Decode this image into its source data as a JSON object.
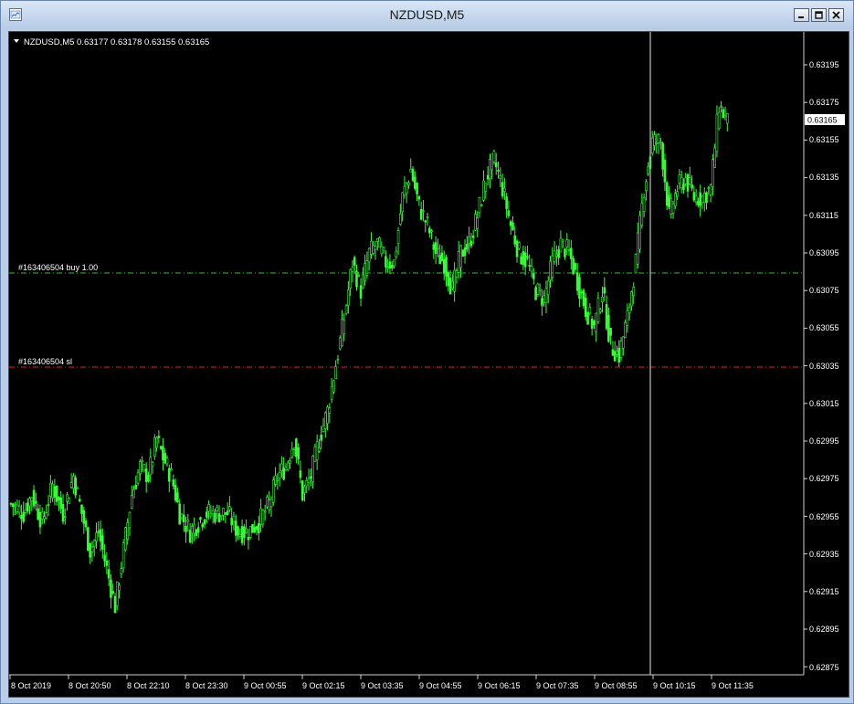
{
  "window": {
    "title": "NZDUSD,M5"
  },
  "chart": {
    "header": "NZDUSD,M5  0.63177 0.63178 0.63155 0.63165",
    "current_price": "0.63165",
    "y_ticks": [
      "0.63195",
      "0.63175",
      "0.63155",
      "0.63135",
      "0.63115",
      "0.63095",
      "0.63075",
      "0.63055",
      "0.63035",
      "0.63015",
      "0.62995",
      "0.62975",
      "0.62955",
      "0.62935",
      "0.62915",
      "0.62895",
      "0.62875"
    ],
    "x_ticks": [
      "8 Oct 2019",
      "8 Oct 20:50",
      "8 Oct 22:10",
      "8 Oct 23:30",
      "9 Oct 00:55",
      "9 Oct 02:15",
      "9 Oct 03:35",
      "9 Oct 04:55",
      "9 Oct 06:15",
      "9 Oct 07:35",
      "9 Oct 08:55",
      "9 Oct 10:15",
      "9 Oct 11:35"
    ],
    "buy_line_label": "#163406504 buy 1.00",
    "sl_line_label": "#163406504 sl",
    "colors": {
      "background": "#000000",
      "candles": "#33ff33",
      "buy_line": "#2fbf2f",
      "sl_line": "#e02020",
      "crosshair": "#e8e8e8",
      "text": "#ffffff"
    }
  },
  "chart_data": {
    "type": "candlestick",
    "symbol": "NZDUSD",
    "timeframe": "M5",
    "ylim": [
      0.62868,
      0.63214
    ],
    "buy_level": 0.63085,
    "sl_level": 0.63035,
    "close_path": [
      [
        0,
        0.6296
      ],
      [
        6,
        0.62955
      ],
      [
        10,
        0.62965
      ],
      [
        15,
        0.6295
      ],
      [
        20,
        0.6297
      ],
      [
        25,
        0.62955
      ],
      [
        30,
        0.62975
      ],
      [
        33,
        0.6296
      ],
      [
        38,
        0.62935
      ],
      [
        42,
        0.62945
      ],
      [
        47,
        0.6292
      ],
      [
        50,
        0.62905
      ],
      [
        54,
        0.62935
      ],
      [
        58,
        0.62965
      ],
      [
        62,
        0.6298
      ],
      [
        66,
        0.62975
      ],
      [
        70,
        0.62995
      ],
      [
        73,
        0.62985
      ],
      [
        77,
        0.62975
      ],
      [
        81,
        0.62955
      ],
      [
        86,
        0.62945
      ],
      [
        90,
        0.6295
      ],
      [
        94,
        0.62955
      ],
      [
        99,
        0.62955
      ],
      [
        104,
        0.62955
      ],
      [
        109,
        0.62945
      ],
      [
        114,
        0.62945
      ],
      [
        119,
        0.6295
      ],
      [
        124,
        0.6296
      ],
      [
        128,
        0.62975
      ],
      [
        132,
        0.6298
      ],
      [
        136,
        0.62995
      ],
      [
        140,
        0.62965
      ],
      [
        144,
        0.62975
      ],
      [
        148,
        0.62995
      ],
      [
        152,
        0.6301
      ],
      [
        156,
        0.63035
      ],
      [
        160,
        0.6306
      ],
      [
        164,
        0.6309
      ],
      [
        168,
        0.63075
      ],
      [
        172,
        0.63095
      ],
      [
        176,
        0.631
      ],
      [
        180,
        0.6309
      ],
      [
        184,
        0.6309
      ],
      [
        188,
        0.63125
      ],
      [
        192,
        0.6314
      ],
      [
        196,
        0.6312
      ],
      [
        200,
        0.6311
      ],
      [
        204,
        0.63095
      ],
      [
        208,
        0.6309
      ],
      [
        212,
        0.63075
      ],
      [
        216,
        0.63095
      ],
      [
        220,
        0.631
      ],
      [
        224,
        0.63115
      ],
      [
        228,
        0.63135
      ],
      [
        232,
        0.63145
      ],
      [
        236,
        0.6313
      ],
      [
        240,
        0.6311
      ],
      [
        244,
        0.63095
      ],
      [
        248,
        0.6309
      ],
      [
        252,
        0.63075
      ],
      [
        256,
        0.6307
      ],
      [
        260,
        0.6309
      ],
      [
        264,
        0.631
      ],
      [
        268,
        0.63095
      ],
      [
        272,
        0.6308
      ],
      [
        276,
        0.63065
      ],
      [
        280,
        0.63055
      ],
      [
        284,
        0.63075
      ],
      [
        288,
        0.63045
      ],
      [
        292,
        0.6304
      ],
      [
        296,
        0.6306
      ],
      [
        300,
        0.6309
      ],
      [
        304,
        0.6313
      ],
      [
        308,
        0.63155
      ],
      [
        312,
        0.63155
      ],
      [
        316,
        0.63115
      ],
      [
        320,
        0.6313
      ],
      [
        324,
        0.63135
      ],
      [
        328,
        0.63125
      ],
      [
        332,
        0.63125
      ],
      [
        336,
        0.6313
      ],
      [
        340,
        0.63175
      ],
      [
        344,
        0.63165
      ]
    ]
  }
}
